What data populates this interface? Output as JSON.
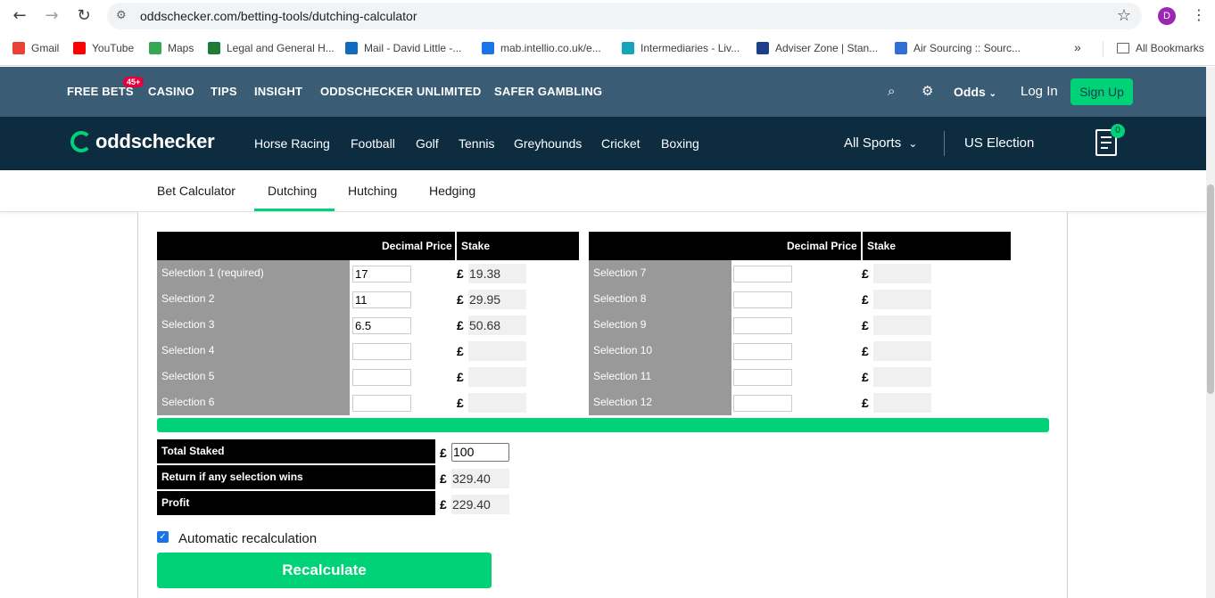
{
  "browser": {
    "url": "oddschecker.com/betting-tools/dutching-calculator",
    "profile_initial": "D",
    "bookmarks": [
      {
        "label": "Gmail",
        "color": "#ea4335"
      },
      {
        "label": "YouTube",
        "color": "#ff0000"
      },
      {
        "label": "Maps",
        "color": "#34a853"
      },
      {
        "label": "Legal and General H...",
        "color": "#1e7b34"
      },
      {
        "label": "Mail - David Little -...",
        "color": "#0f6cbd"
      },
      {
        "label": "mab.intellio.co.uk/e...",
        "color": "#1a73e8"
      },
      {
        "label": "Intermediaries - Liv...",
        "color": "#14a3b8"
      },
      {
        "label": "Adviser Zone | Stan...",
        "color": "#1d3f8a"
      },
      {
        "label": "Air Sourcing :: Sourc...",
        "color": "#2f6fd6"
      }
    ],
    "more_bookmarks": "»",
    "all_bookmarks": "All Bookmarks"
  },
  "site": {
    "top_links": [
      "FREE BETS",
      "CASINO",
      "TIPS",
      "INSIGHT",
      "ODDSCHECKER UNLIMITED",
      "SAFER GAMBLING"
    ],
    "free_bets_badge": "45+",
    "odds_label": "Odds",
    "login": "Log In",
    "signup": "Sign Up",
    "logo_text": "oddschecker",
    "sports": [
      "Horse Racing",
      "Football",
      "Golf",
      "Tennis",
      "Greyhounds",
      "Cricket",
      "Boxing"
    ],
    "all_sports": "All Sports",
    "us_election": "US Election",
    "betslip_count": "0",
    "tabs": [
      "Bet Calculator",
      "Dutching",
      "Hutching",
      "Hedging"
    ],
    "active_tab": "Dutching"
  },
  "calculator": {
    "header_price": "Decimal Price",
    "header_stake": "Stake",
    "currency": "£",
    "left_selections": [
      {
        "label": "Selection 1 (required)",
        "price": "17",
        "stake": "19.38"
      },
      {
        "label": "Selection 2",
        "price": "11",
        "stake": "29.95"
      },
      {
        "label": "Selection 3",
        "price": "6.5",
        "stake": "50.68"
      },
      {
        "label": "Selection 4",
        "price": "",
        "stake": ""
      },
      {
        "label": "Selection 5",
        "price": "",
        "stake": ""
      },
      {
        "label": "Selection 6",
        "price": "",
        "stake": ""
      }
    ],
    "right_selections": [
      {
        "label": "Selection 7",
        "price": "",
        "stake": ""
      },
      {
        "label": "Selection 8",
        "price": "",
        "stake": ""
      },
      {
        "label": "Selection 9",
        "price": "",
        "stake": ""
      },
      {
        "label": "Selection 10",
        "price": "",
        "stake": ""
      },
      {
        "label": "Selection 11",
        "price": "",
        "stake": ""
      },
      {
        "label": "Selection 12",
        "price": "",
        "stake": ""
      }
    ],
    "total_staked_label": "Total Staked",
    "total_staked": "100",
    "return_label": "Return if any selection wins",
    "return_value": "329.40",
    "profit_label": "Profit",
    "profit_value": "229.40",
    "auto_recalc_label": "Automatic recalculation",
    "auto_recalc_checked": true,
    "recalculate_button": "Recalculate"
  }
}
